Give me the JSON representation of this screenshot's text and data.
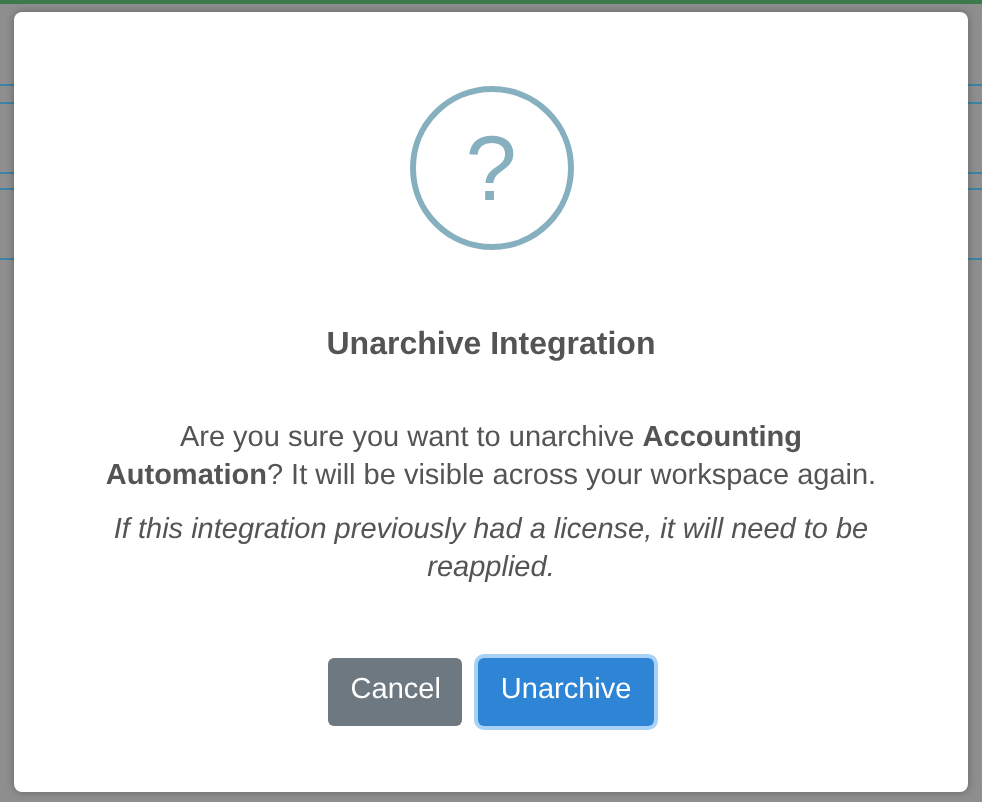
{
  "dialog": {
    "icon": "?",
    "title": "Unarchive Integration",
    "message": "Are you sure you want to unarchive **Accounting Automation**? It will be visible across your workspace again.",
    "note": "If this integration previously had a license, it will need to be reapplied.",
    "buttons": [
      {
        "label": "Cancel",
        "kind": "secondary",
        "focused": false
      },
      {
        "label": "Unarchive",
        "kind": "primary",
        "focused": true
      }
    ]
  }
}
